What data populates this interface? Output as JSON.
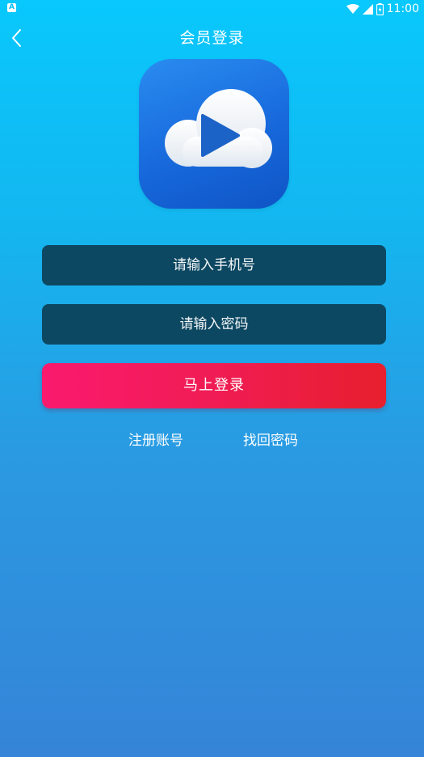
{
  "status_bar": {
    "notification_icon_letter": "A",
    "time": "11:00",
    "icons": [
      "wifi-icon",
      "signal-icon",
      "battery-icon"
    ]
  },
  "header": {
    "title": "会员登录",
    "back_icon": "chevron-left-icon"
  },
  "logo": {
    "icon": "cloud-play-icon"
  },
  "form": {
    "phone_placeholder": "请输入手机号",
    "password_placeholder": "请输入密码",
    "login_label": "马上登录"
  },
  "links": {
    "register": "注册账号",
    "forgot_password": "找回密码"
  },
  "colors": {
    "background_top": "#08c8fc",
    "background_bottom": "#3584d8",
    "input_bg": "#0d4862",
    "button_start": "#fb1a6e",
    "button_end": "#e71f2d",
    "logo_blue": "#1769dc"
  }
}
